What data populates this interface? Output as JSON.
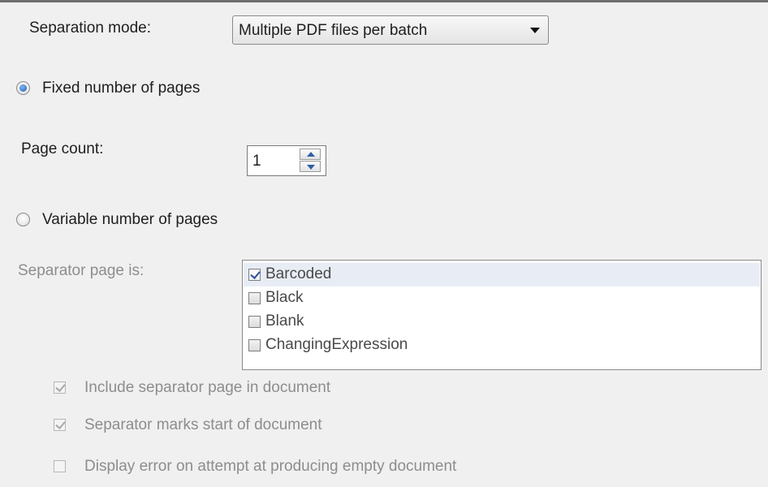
{
  "separation_mode": {
    "label": "Separation mode:",
    "selected": "Multiple PDF files per batch"
  },
  "fixed": {
    "label": "Fixed number of pages",
    "selected": true
  },
  "page_count": {
    "label": "Page count:",
    "value": "1"
  },
  "variable": {
    "label": "Variable number of pages",
    "selected": false
  },
  "separator": {
    "label": "Separator page is:",
    "items": [
      {
        "label": "Barcoded",
        "checked": true
      },
      {
        "label": "Black",
        "checked": false
      },
      {
        "label": "Blank",
        "checked": false
      },
      {
        "label": "ChangingExpression",
        "checked": false
      }
    ]
  },
  "options": [
    {
      "label": "Include separator page in document",
      "checked": true
    },
    {
      "label": "Separator marks start of document",
      "checked": true
    },
    {
      "label": "Display error on attempt at producing empty document",
      "checked": false
    }
  ],
  "colors": {
    "background": "#f0f0f0",
    "radio_accent": "#1d5fb5",
    "check_mark": "#2b4f9e",
    "disabled_text": "#8d8d8d"
  }
}
